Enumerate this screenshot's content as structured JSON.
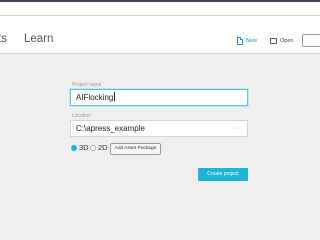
{
  "nav": {
    "tabs": [
      {
        "label": "ts"
      },
      {
        "label": "Learn"
      }
    ],
    "new_label": "New",
    "open_label": "Open"
  },
  "form": {
    "project_name_label": "Project name",
    "project_name_value": "AIFlocking",
    "location_label": "Location",
    "location_value": "C:\\apress_example",
    "location_browse": "···",
    "mode_3d_label": "3D",
    "mode_2d_label": "2D",
    "selected_mode": "3D",
    "asset_package_label": "Add Asset Package",
    "create_label": "Create project"
  },
  "colors": {
    "accent": "#1fb3d8",
    "link": "#1a8fd9",
    "background": "#efefef"
  }
}
